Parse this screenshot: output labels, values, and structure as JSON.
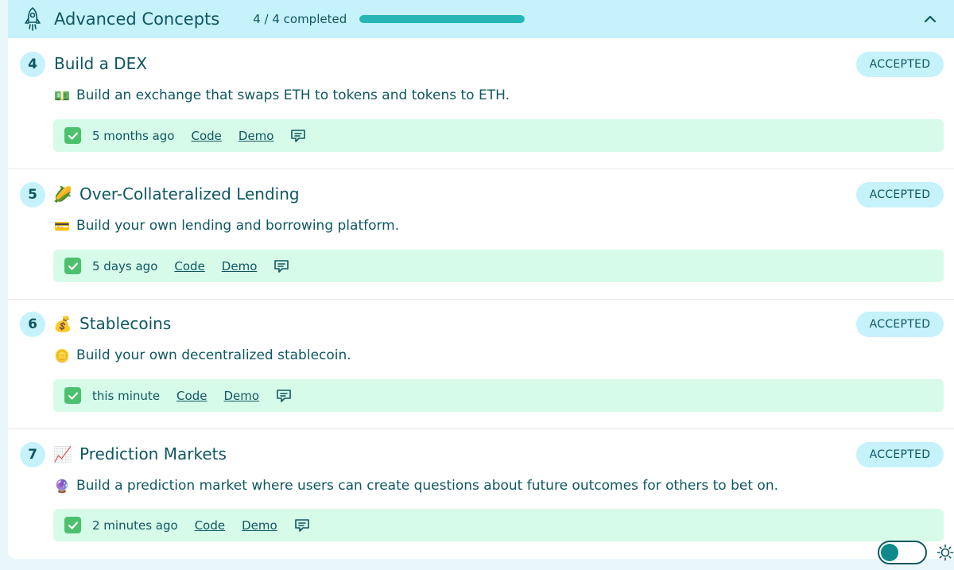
{
  "header": {
    "title": "Advanced Concepts",
    "progress_text": "4 / 4 completed",
    "progress_fraction": 1.0,
    "icon": "rocket-icon"
  },
  "challenges": [
    {
      "number": "4",
      "title": "Build a DEX",
      "title_emoji": "",
      "desc_emoji": "💵",
      "description": "Build an exchange that swaps ETH to tokens and tokens to ETH.",
      "status": "ACCEPTED",
      "time": "5 months ago",
      "code_label": "Code",
      "demo_label": "Demo"
    },
    {
      "number": "5",
      "title": "Over-Collateralized Lending",
      "title_emoji": "🌽",
      "desc_emoji": "💳",
      "description": "Build your own lending and borrowing platform.",
      "status": "ACCEPTED",
      "time": "5 days ago",
      "code_label": "Code",
      "demo_label": "Demo"
    },
    {
      "number": "6",
      "title": "Stablecoins",
      "title_emoji": "💰",
      "desc_emoji": "🪙",
      "description": "Build your own decentralized stablecoin.",
      "status": "ACCEPTED",
      "time": "this minute",
      "code_label": "Code",
      "demo_label": "Demo"
    },
    {
      "number": "7",
      "title": "Prediction Markets",
      "title_emoji": "📈",
      "desc_emoji": "🔮",
      "description": "Build a prediction market where users can create questions about future outcomes for others to bet on.",
      "status": "ACCEPTED",
      "time": "2 minutes ago",
      "code_label": "Code",
      "demo_label": "Demo"
    }
  ],
  "colors": {
    "accent": "#0e5761",
    "header_bg": "#c6f2fb",
    "progress_fill": "#26b6b6",
    "meta_bg": "#d7fbe9",
    "check": "#4cc16d"
  },
  "footer": {
    "theme_toggle_icon": "toggle-switch",
    "sun_icon": "sun-icon"
  }
}
